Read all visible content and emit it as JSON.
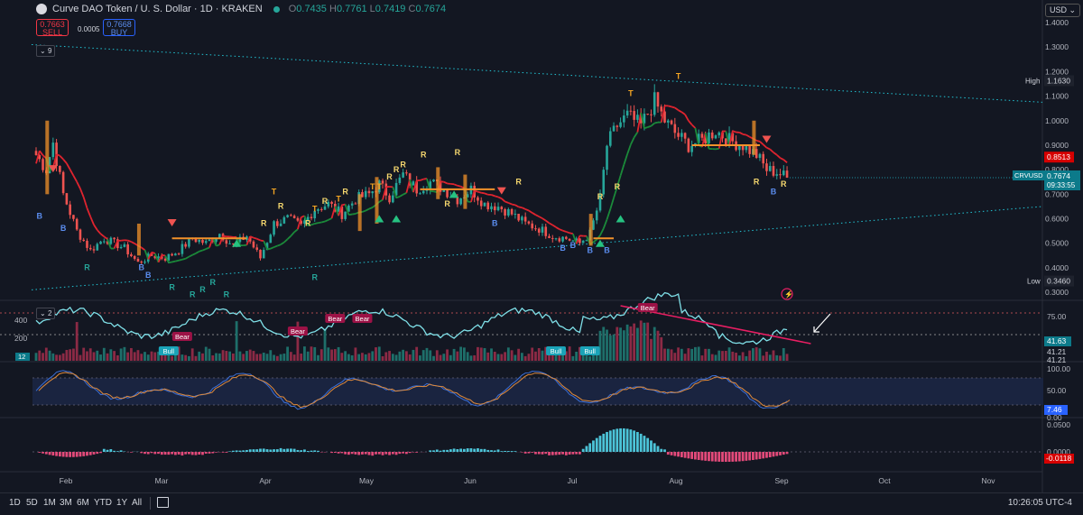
{
  "header": {
    "title": "Curve DAO Token / U. S. Dollar · 1D · KRAKEN",
    "ohlc": [
      {
        "k": "O",
        "v": "0.7435"
      },
      {
        "k": "H",
        "v": "0.7761"
      },
      {
        "k": "L",
        "v": "0.7419"
      },
      {
        "k": "C",
        "v": "0.7674"
      }
    ],
    "sell_price": "0.7663",
    "sell_label": "SELL",
    "spread": "0.0005",
    "buy_price": "0.7668",
    "buy_label": "BUY",
    "currency": "USD",
    "indicator_count": "9",
    "volume_pane_count": "2"
  },
  "colors": {
    "bg": "#131722",
    "up": "#26a69a",
    "down": "#ef5350",
    "teal": "#22c4d4",
    "red_ma": "#e0242f",
    "green_ma": "#1b8a3a",
    "orange": "#f2922a",
    "pink": "#e91e63",
    "blue": "#2962ff"
  },
  "chart_data": [
    {
      "type": "candlestick",
      "title": "Curve DAO Token / U. S. Dollar · 1D · KRAKEN",
      "x_ticks": [
        "Feb",
        "Mar",
        "Apr",
        "May",
        "Jun",
        "Jul",
        "Aug",
        "Sep",
        "Oct",
        "Nov"
      ],
      "y_ticks": [
        "1.4000",
        "1.3000",
        "1.2000",
        "1.1000",
        "1.0000",
        "0.9000",
        "0.8000",
        "0.7000",
        "0.6000",
        "0.5000",
        "0.4000",
        "0.3000"
      ],
      "ylim": [
        0.3,
        1.4
      ],
      "anchors_close": [
        [
          0,
          0.86
        ],
        [
          3,
          0.8
        ],
        [
          5,
          0.91
        ],
        [
          8,
          0.7
        ],
        [
          12,
          0.55
        ],
        [
          16,
          0.47
        ],
        [
          20,
          0.52
        ],
        [
          26,
          0.48
        ],
        [
          30,
          0.42
        ],
        [
          34,
          0.45
        ],
        [
          38,
          0.44
        ],
        [
          42,
          0.47
        ],
        [
          46,
          0.52
        ],
        [
          50,
          0.5
        ],
        [
          54,
          0.54
        ],
        [
          58,
          0.49
        ],
        [
          62,
          0.53
        ],
        [
          66,
          0.44
        ],
        [
          70,
          0.58
        ],
        [
          74,
          0.6
        ],
        [
          78,
          0.57
        ],
        [
          82,
          0.64
        ],
        [
          86,
          0.66
        ],
        [
          90,
          0.62
        ],
        [
          94,
          0.68
        ],
        [
          98,
          0.7
        ],
        [
          101,
          0.74
        ],
        [
          104,
          0.69
        ],
        [
          108,
          0.78
        ],
        [
          112,
          0.72
        ],
        [
          116,
          0.75
        ],
        [
          120,
          0.72
        ],
        [
          124,
          0.68
        ],
        [
          128,
          0.72
        ],
        [
          132,
          0.66
        ],
        [
          136,
          0.65
        ],
        [
          140,
          0.62
        ],
        [
          144,
          0.58
        ],
        [
          148,
          0.56
        ],
        [
          152,
          0.53
        ],
        [
          156,
          0.52
        ],
        [
          160,
          0.5
        ],
        [
          163,
          0.54
        ],
        [
          166,
          0.68
        ],
        [
          168,
          0.9
        ],
        [
          171,
          0.98
        ],
        [
          174,
          1.02
        ],
        [
          178,
          0.98
        ],
        [
          182,
          1.08
        ],
        [
          185,
          1.0
        ],
        [
          188,
          0.95
        ],
        [
          192,
          0.9
        ],
        [
          196,
          0.92
        ],
        [
          200,
          0.96
        ],
        [
          204,
          0.92
        ],
        [
          208,
          0.9
        ],
        [
          212,
          0.86
        ],
        [
          215,
          0.8
        ],
        [
          218,
          0.79
        ],
        [
          221,
          0.7674
        ]
      ],
      "labels": {
        "high": "High",
        "high_value": "1.1630",
        "low": "Low",
        "low_value": "0.3460",
        "ma_value": "0.8513",
        "pair": "CRVUSD",
        "last": "0.7674",
        "countdown": "09:33:55"
      },
      "signals": [
        {
          "t": "B",
          "i": 1,
          "p": 0.6
        },
        {
          "t": "B",
          "i": 8,
          "p": 0.55
        },
        {
          "t": "R",
          "i": 15,
          "p": 0.39
        },
        {
          "t": "B",
          "i": 31,
          "p": 0.39
        },
        {
          "t": "B",
          "i": 33,
          "p": 0.36
        },
        {
          "t": "R",
          "i": 40,
          "p": 0.31
        },
        {
          "t": "R",
          "i": 46,
          "p": 0.28
        },
        {
          "t": "R",
          "i": 49,
          "p": 0.3
        },
        {
          "t": "R",
          "i": 56,
          "p": 0.28
        },
        {
          "t": "R",
          "i": 52,
          "p": 0.33
        },
        {
          "t": "R",
          "i": 67,
          "p": 0.57
        },
        {
          "t": "T",
          "i": 70,
          "p": 0.7
        },
        {
          "t": "R",
          "i": 72,
          "p": 0.64
        },
        {
          "t": "T",
          "i": 82,
          "p": 0.63
        },
        {
          "t": "R",
          "i": 80,
          "p": 0.57
        },
        {
          "t": "R",
          "i": 82,
          "p": 0.35
        },
        {
          "t": "R",
          "i": 85,
          "p": 0.66
        },
        {
          "t": "T",
          "i": 89,
          "p": 0.67
        },
        {
          "t": "R",
          "i": 91,
          "p": 0.7
        },
        {
          "t": "T",
          "i": 99,
          "p": 0.72
        },
        {
          "t": "T",
          "i": 101,
          "p": 0.72
        },
        {
          "t": "R",
          "i": 104,
          "p": 0.76
        },
        {
          "t": "R",
          "i": 106,
          "p": 0.79
        },
        {
          "t": "R",
          "i": 108,
          "p": 0.81
        },
        {
          "t": "R",
          "i": 114,
          "p": 0.85
        },
        {
          "t": "R",
          "i": 124,
          "p": 0.86
        },
        {
          "t": "R",
          "i": 121,
          "p": 0.65
        },
        {
          "t": "R",
          "i": 142,
          "p": 0.74
        },
        {
          "t": "B",
          "i": 135,
          "p": 0.57
        },
        {
          "t": "B",
          "i": 155,
          "p": 0.47
        },
        {
          "t": "B",
          "i": 158,
          "p": 0.48
        },
        {
          "t": "B",
          "i": 163,
          "p": 0.46
        },
        {
          "t": "B",
          "i": 168,
          "p": 0.46
        },
        {
          "t": "R",
          "i": 166,
          "p": 0.68
        },
        {
          "t": "R",
          "i": 171,
          "p": 0.72
        },
        {
          "t": "T",
          "i": 175,
          "p": 1.1
        },
        {
          "t": "T",
          "i": 189,
          "p": 1.17
        },
        {
          "t": "R",
          "i": 212,
          "p": 0.74
        },
        {
          "t": "B",
          "i": 217,
          "p": 0.7
        },
        {
          "t": "R",
          "i": 220,
          "p": 0.73
        }
      ],
      "triangles": [
        {
          "d": "down",
          "i": 5,
          "p": 0.8
        },
        {
          "d": "down",
          "i": 40,
          "p": 0.58
        },
        {
          "d": "down",
          "i": 137,
          "p": 0.71
        },
        {
          "d": "down",
          "i": 215,
          "p": 0.92
        },
        {
          "d": "up",
          "i": 59,
          "p": 0.5
        },
        {
          "d": "up",
          "i": 101,
          "p": 0.6
        },
        {
          "d": "up",
          "i": 106,
          "p": 0.6
        },
        {
          "d": "up",
          "i": 123,
          "p": 0.7
        },
        {
          "d": "up",
          "i": 166,
          "p": 0.5
        },
        {
          "d": "up",
          "i": 172,
          "p": 0.6
        }
      ]
    },
    {
      "type": "line",
      "x_ticks": [
        "Feb",
        "Mar",
        "Apr",
        "May",
        "Jun",
        "Jul",
        "Aug",
        "Sep",
        "Oct",
        "Nov"
      ],
      "y_ticks": [
        "400",
        "200"
      ],
      "right_ticks": [
        "75.00"
      ],
      "values_shown": [
        "41.63",
        "41.21",
        "41.21"
      ],
      "left_badge": "12",
      "annotations": [
        {
          "text": "Bear",
          "i": 43
        },
        {
          "text": "Bull",
          "i": 39
        },
        {
          "text": "Bear",
          "i": 77
        },
        {
          "text": "Bear",
          "i": 88
        },
        {
          "text": "Bear",
          "i": 96
        },
        {
          "text": "Bull",
          "i": 153
        },
        {
          "text": "Bull",
          "i": 163
        },
        {
          "text": "Bear",
          "i": 180
        }
      ]
    },
    {
      "type": "line",
      "x_ticks": [
        "Feb",
        "Mar",
        "Apr",
        "May",
        "Jun",
        "Jul",
        "Aug",
        "Sep",
        "Oct",
        "Nov"
      ],
      "y_ticks": [
        "100.00",
        "50.00",
        "0.00"
      ],
      "value_shown": "7.46"
    },
    {
      "type": "bar",
      "x_ticks": [
        "Feb",
        "Mar",
        "Apr",
        "May",
        "Jun",
        "Jul",
        "Aug",
        "Sep",
        "Oct",
        "Nov"
      ],
      "y_ticks": [
        "0.0500",
        "0.0000"
      ],
      "value_shown": "-0.0118"
    }
  ],
  "toolbar": {
    "timeframes": [
      "1D",
      "5D",
      "1M",
      "3M",
      "6M",
      "YTD",
      "1Y",
      "All"
    ],
    "clock": "10:26:05 UTC-4"
  }
}
